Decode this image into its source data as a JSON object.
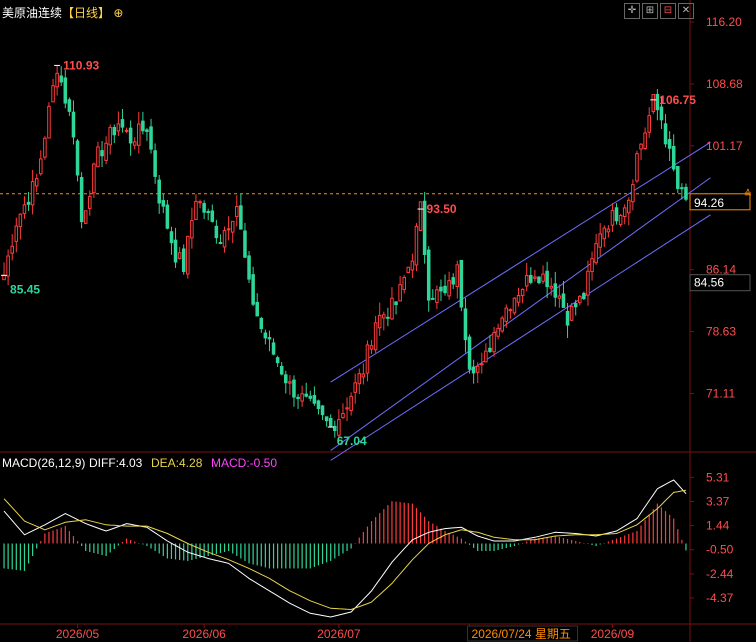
{
  "header": {
    "symbol": "美原油连续",
    "period": "【日线】",
    "settings_icon": "crosshair-settings-icon"
  },
  "toolbar": [
    {
      "icon": "expand-icon",
      "glyph": "✛"
    },
    {
      "icon": "grid-icon",
      "glyph": "⊞"
    },
    {
      "icon": "candle-icon",
      "glyph": "⊟"
    },
    {
      "icon": "close-icon",
      "glyph": "✕"
    }
  ],
  "colors": {
    "up": "#ff3b3b",
    "down": "#2fd69a",
    "diff_line": "#ffffff",
    "dea_line": "#e8d44a",
    "channel": "#6f6fff",
    "current_price_line": "#ff8c00",
    "axis_text": "#ff4d4d",
    "macd_axis_text": "#ff4d4d"
  },
  "chart_data": [
    {
      "type": "candlestick",
      "title": "美原油连续【日线】",
      "yaxis_ticks": [
        "116.20",
        "108.68",
        "101.17",
        "94.26",
        "86.14",
        "84.56",
        "78.63",
        "71.11"
      ],
      "ylim": [
        64.5,
        116.2
      ],
      "current_price": "94.26",
      "marker_price": "84.56",
      "annotations": [
        {
          "label": "110.93",
          "type": "high",
          "value": 110.93,
          "bar": 13
        },
        {
          "label": "85.45",
          "type": "low",
          "value": 85.45,
          "bar": 0
        },
        {
          "label": "67.04",
          "type": "low",
          "value": 67.04,
          "bar": 80
        },
        {
          "label": "93.50",
          "type": "high",
          "value": 93.5,
          "bar": 102
        },
        {
          "label": "106.75",
          "type": "high",
          "value": 106.75,
          "bar": 159
        }
      ],
      "x_labels": [
        "2026/05",
        "2026/06",
        "2026/07",
        "2026/07/24 星期五",
        "2026/09"
      ],
      "x_label_bars": [
        18,
        49,
        82,
        114,
        149
      ],
      "waypoints": [
        [
          0,
          85.5
        ],
        [
          3,
          92.0
        ],
        [
          8,
          97.0
        ],
        [
          13,
          110.9
        ],
        [
          17,
          103.0
        ],
        [
          19,
          92.0
        ],
        [
          23,
          100.0
        ],
        [
          28,
          104.0
        ],
        [
          31,
          102.0
        ],
        [
          35,
          103.5
        ],
        [
          38,
          95.0
        ],
        [
          42,
          88.0
        ],
        [
          44,
          86.5
        ],
        [
          47,
          95.0
        ],
        [
          50,
          92.5
        ],
        [
          53,
          90.0
        ],
        [
          57,
          94.0
        ],
        [
          60,
          84.0
        ],
        [
          63,
          79.0
        ],
        [
          66,
          76.0
        ],
        [
          70,
          72.0
        ],
        [
          76,
          69.0
        ],
        [
          80,
          67.0
        ],
        [
          83,
          69.0
        ],
        [
          88,
          74.0
        ],
        [
          91,
          80.0
        ],
        [
          96,
          82.0
        ],
        [
          100,
          88.0
        ],
        [
          102,
          93.5
        ],
        [
          104,
          83.5
        ],
        [
          108,
          83.0
        ],
        [
          111,
          86.0
        ],
        [
          114,
          75.0
        ],
        [
          117,
          74.0
        ],
        [
          121,
          80.0
        ],
        [
          125,
          83.0
        ],
        [
          130,
          86.0
        ],
        [
          133,
          85.0
        ],
        [
          136,
          83.0
        ],
        [
          138,
          80.5
        ],
        [
          142,
          83.0
        ],
        [
          146,
          91.0
        ],
        [
          150,
          93.0
        ],
        [
          153,
          95.0
        ],
        [
          155,
          100.0
        ],
        [
          157,
          103.0
        ],
        [
          159,
          106.5
        ],
        [
          161,
          104.5
        ],
        [
          163,
          100.0
        ],
        [
          165,
          96.0
        ],
        [
          167,
          94.3
        ]
      ],
      "channel_lines": [
        {
          "name": "upper",
          "from": [
            80,
            72.5
          ],
          "to": [
            173,
            101.6
          ]
        },
        {
          "name": "middle",
          "from": [
            80,
            64.2
          ],
          "to": [
            173,
            97.3
          ]
        },
        {
          "name": "lower",
          "from": [
            80,
            63.0
          ],
          "to": [
            173,
            92.8
          ]
        }
      ]
    },
    {
      "type": "macd",
      "title": "MACD(26,12,9)",
      "legend": [
        {
          "label": "MACD(26,12,9)",
          "color": "#ffffff"
        },
        {
          "label": "DIFF:4.03",
          "color": "#ffffff"
        },
        {
          "label": "DEA:4.28",
          "color": "#e8d44a"
        },
        {
          "label": "MACD:-0.50",
          "color": "#ff44ff"
        }
      ],
      "yaxis_ticks": [
        "5.31",
        "3.37",
        "1.44",
        "-0.50",
        "-2.44",
        "-4.37"
      ],
      "ylim": [
        -6.3,
        5.9
      ],
      "diff_waypoints": [
        [
          0,
          2.6
        ],
        [
          5,
          0.7
        ],
        [
          10,
          1.5
        ],
        [
          15,
          2.4
        ],
        [
          20,
          1.6
        ],
        [
          25,
          1.0
        ],
        [
          30,
          1.6
        ],
        [
          35,
          1.3
        ],
        [
          40,
          0.2
        ],
        [
          45,
          -0.7
        ],
        [
          50,
          -1.2
        ],
        [
          55,
          -1.6
        ],
        [
          60,
          -2.8
        ],
        [
          65,
          -3.8
        ],
        [
          70,
          -4.8
        ],
        [
          75,
          -5.6
        ],
        [
          80,
          -5.9
        ],
        [
          85,
          -5.5
        ],
        [
          90,
          -3.8
        ],
        [
          95,
          -1.5
        ],
        [
          100,
          0.3
        ],
        [
          104,
          0.9
        ],
        [
          108,
          1.2
        ],
        [
          112,
          1.3
        ],
        [
          116,
          0.6
        ],
        [
          120,
          0.2
        ],
        [
          125,
          0.2
        ],
        [
          130,
          0.5
        ],
        [
          135,
          0.9
        ],
        [
          140,
          0.8
        ],
        [
          145,
          0.6
        ],
        [
          150,
          1.0
        ],
        [
          155,
          2.0
        ],
        [
          160,
          4.4
        ],
        [
          164,
          5.1
        ],
        [
          167,
          4.0
        ]
      ],
      "dea_waypoints": [
        [
          0,
          3.6
        ],
        [
          5,
          1.8
        ],
        [
          10,
          1.1
        ],
        [
          15,
          1.7
        ],
        [
          20,
          1.9
        ],
        [
          25,
          1.5
        ],
        [
          30,
          1.4
        ],
        [
          35,
          1.4
        ],
        [
          40,
          0.8
        ],
        [
          45,
          0.0
        ],
        [
          50,
          -0.7
        ],
        [
          55,
          -1.3
        ],
        [
          60,
          -2.0
        ],
        [
          65,
          -2.8
        ],
        [
          70,
          -3.8
        ],
        [
          75,
          -4.6
        ],
        [
          80,
          -5.2
        ],
        [
          85,
          -5.3
        ],
        [
          90,
          -4.7
        ],
        [
          95,
          -3.2
        ],
        [
          100,
          -1.3
        ],
        [
          104,
          0.0
        ],
        [
          108,
          0.7
        ],
        [
          112,
          1.1
        ],
        [
          116,
          0.9
        ],
        [
          120,
          0.5
        ],
        [
          125,
          0.3
        ],
        [
          130,
          0.3
        ],
        [
          135,
          0.6
        ],
        [
          140,
          0.7
        ],
        [
          145,
          0.7
        ],
        [
          150,
          0.8
        ],
        [
          155,
          1.5
        ],
        [
          160,
          2.8
        ],
        [
          164,
          4.1
        ],
        [
          167,
          4.28
        ]
      ]
    }
  ]
}
